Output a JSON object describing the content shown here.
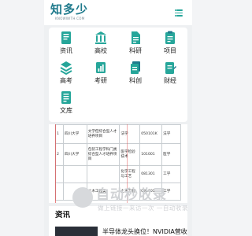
{
  "header": {
    "logo_text": "知多少",
    "logo_sub": "KNOWWITH.COM",
    "menu_icon": "menu-icon"
  },
  "colors": {
    "accent": "#26a69a",
    "accent_dark": "#1f7a8c",
    "table_rule": "#dd3333",
    "watermark": "#d0d2d5"
  },
  "categories": [
    {
      "label": "资讯",
      "icon": "news-icon"
    },
    {
      "label": "高校",
      "icon": "university-icon"
    },
    {
      "label": "科研",
      "icon": "document-icon"
    },
    {
      "label": "项目",
      "icon": "clipboard-icon"
    },
    {
      "label": "高考",
      "icon": "layers-icon"
    },
    {
      "label": "考研",
      "icon": "chart-icon"
    },
    {
      "label": "科创",
      "icon": "file-stack-icon"
    },
    {
      "label": "财经",
      "icon": "pen-icon"
    },
    {
      "label": "文库",
      "icon": "library-icon"
    }
  ],
  "table": {
    "rows": [
      {
        "num": "1",
        "school": "四川大学",
        "field": "文学但综合型人才培养项目",
        "major": "法学",
        "code": "050101K",
        "type": "法学"
      },
      {
        "num": "2",
        "school": "四川大学",
        "field": "包装工程学科门类综合型人才培养项目",
        "major": "医学检验技术",
        "code": "101001",
        "type": "医学"
      },
      {
        "num": "",
        "school": "",
        "field": "",
        "major": "化学工程与工艺",
        "code": "081301",
        "type": "工学"
      },
      {
        "num": "",
        "school": "",
        "field": "土木工程类",
        "major": "土木工程",
        "code": "081001",
        "type": "工学"
      }
    ]
  },
  "watermark": {
    "title": "自动秒收录",
    "subtitle": "做上链接一来访一次 一自动收录"
  },
  "news": {
    "heading": "资讯",
    "first_title": "半导体龙头换位！NVIDIA营收"
  }
}
